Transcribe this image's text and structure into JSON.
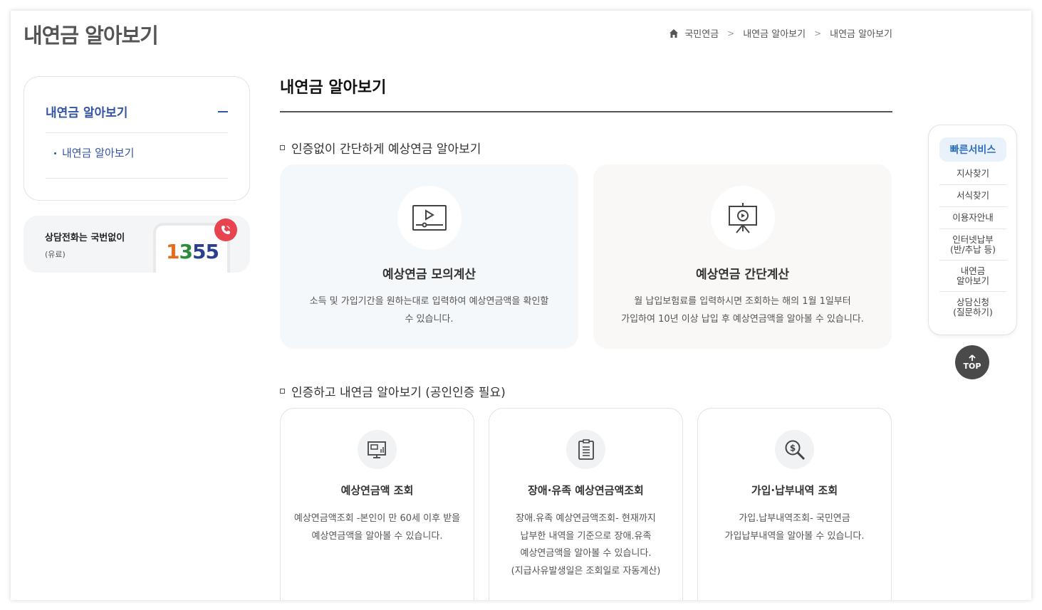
{
  "page": {
    "title": "내연금 알아보기"
  },
  "breadcrumb": [
    "국민연금",
    "내연금 알아보기",
    "내연금 알아보기"
  ],
  "lnb": {
    "head": "내연금 알아보기",
    "sub_item": "내연금 알아보기"
  },
  "call": {
    "line1": "상담전화는 국번없이",
    "line2": "(유료)",
    "digits": [
      "1",
      "3",
      "5",
      "5"
    ]
  },
  "content": {
    "title": "내연금 알아보기"
  },
  "section1": {
    "title": "인증없이 간단하게 예상연금 알아보기",
    "cards": [
      {
        "title": "예상연금 모의계산",
        "desc_lines": [
          "소득 및 가입기간을 원하는대로 입력하여 예상연금액을 확인할",
          "수 있습니다."
        ]
      },
      {
        "title": "예상연금 간단계산",
        "desc_lines": [
          "월 납입보험료를 입력하시면 조회하는 해의 1월 1일부터",
          "가입하여 10년 이상 납입 후 예상연금액을 알아볼 수 있습니다."
        ]
      }
    ]
  },
  "section2": {
    "title": "인증하고 내연금 알아보기 (공인인증 필요)",
    "cards": [
      {
        "title": "예상연금액 조회",
        "desc_lines": [
          "예상연금액조회 -본인이 만 60세 이후 받을",
          "예상연금액을 알아볼 수 있습니다."
        ]
      },
      {
        "title": "장애·유족 예상연금액조회",
        "desc_lines": [
          "장애.유족 예상연금액조회- 현재까지",
          "납부한 내역을 기준으로 장애.유족",
          "예상연금액을 알아볼 수 있습니다.",
          "(지급사유발생일은 조회일로 자동계산)"
        ]
      },
      {
        "title": "가입·납부내역 조회",
        "desc_lines": [
          "가입.납부내역조회- 국민연금",
          "가입납부내역을 알아볼 수 있습니다."
        ]
      }
    ]
  },
  "quick": {
    "title": "빠른서비스",
    "items": [
      [
        "지사찾기"
      ],
      [
        "서식찾기"
      ],
      [
        "이용자안내"
      ],
      [
        "인터넷납부",
        "(반/추납 등)"
      ],
      [
        "내연금",
        "알아보기"
      ],
      [
        "상담신청",
        "(질문하기)"
      ]
    ],
    "top_label": "TOP"
  },
  "colors": {
    "accent": "#3253a6",
    "quick_accent": "#2f6fc1",
    "call_red": "#e8434e"
  }
}
